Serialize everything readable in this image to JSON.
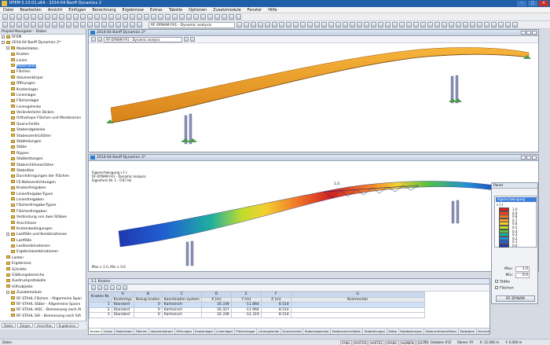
{
  "app": {
    "title": "RFEM 5.10.01.x64 - 2014-04 Banff Dynamics 2",
    "menus": [
      "Datei",
      "Bearbeiten",
      "Ansicht",
      "Einfügen",
      "Berechnung",
      "Ergebnisse",
      "Extras",
      "Tabelle",
      "Optionen",
      "Zusatzmodule",
      "Fenster",
      "Hilfe"
    ],
    "toolbar_select": "RF-DYNAM FA1 - Dynamic analysis"
  },
  "navigator": {
    "title": "Projekt-Navigator - Daten",
    "items": [
      {
        "label": "RFEM",
        "level": 0,
        "exp": true
      },
      {
        "label": "2014-04 Banff Dynamics 2*",
        "level": 0,
        "exp": true
      },
      {
        "label": "Modelldaten",
        "level": 1,
        "exp": true
      },
      {
        "label": "Knoten",
        "level": 2
      },
      {
        "label": "Linien",
        "level": 2
      },
      {
        "label": "Materialien",
        "level": 2,
        "sel": true
      },
      {
        "label": "Flächen",
        "level": 2
      },
      {
        "label": "Volumenkörper",
        "level": 2
      },
      {
        "label": "Öffnungen",
        "level": 2
      },
      {
        "label": "Knotenlager",
        "level": 2
      },
      {
        "label": "Linienlager",
        "level": 2
      },
      {
        "label": "Flächenlager",
        "level": 2
      },
      {
        "label": "Liniengelenke",
        "level": 2
      },
      {
        "label": "Veränderliche Dicken",
        "level": 2
      },
      {
        "label": "Orthotrope Flächen und Membranen",
        "level": 2
      },
      {
        "label": "Querschnitte",
        "level": 2
      },
      {
        "label": "Stabendgelenke",
        "level": 2
      },
      {
        "label": "Stabexzentrizitäten",
        "level": 2
      },
      {
        "label": "Stabteilungen",
        "level": 2
      },
      {
        "label": "Stäbe",
        "level": 2
      },
      {
        "label": "Rippen",
        "level": 2
      },
      {
        "label": "Stabbettungen",
        "level": 2
      },
      {
        "label": "Stabnichtlinearitäten",
        "level": 2
      },
      {
        "label": "Stabsätze",
        "level": 2
      },
      {
        "label": "Durchdringungen der Flächen",
        "level": 2
      },
      {
        "label": "FE-Netzverdichtungen",
        "level": 2
      },
      {
        "label": "Knotenfreigaben",
        "level": 2
      },
      {
        "label": "Linienfreigabe-Typen",
        "level": 2
      },
      {
        "label": "Linienfreigaben",
        "level": 2
      },
      {
        "label": "Flächenfreigabe-Typen",
        "level": 2
      },
      {
        "label": "Flächenfreigaben",
        "level": 2
      },
      {
        "label": "Verbindung von zwei Stäben",
        "level": 2
      },
      {
        "label": "Anschlüsse",
        "level": 2
      },
      {
        "label": "Knotenbedingungen",
        "level": 2
      },
      {
        "label": "Lastfälle und Kombinationen",
        "level": 1,
        "exp": true
      },
      {
        "label": "Lastfälle",
        "level": 2
      },
      {
        "label": "Lastkombinationen",
        "level": 2
      },
      {
        "label": "Ergebniskombinationen",
        "level": 2
      },
      {
        "label": "Lasten",
        "level": 1
      },
      {
        "label": "Ergebnisse",
        "level": 1
      },
      {
        "label": "Schnitte",
        "level": 1
      },
      {
        "label": "Glättungsbereiche",
        "level": 1
      },
      {
        "label": "Ausdruckprotokolle",
        "level": 1
      },
      {
        "label": "Hilfsobjekte",
        "level": 1
      },
      {
        "label": "Zusatzmodule",
        "level": 1,
        "exp": true
      },
      {
        "label": "RF-STAHL Flächen - Allgemeine Span",
        "level": 2
      },
      {
        "label": "RF-STAHL Stäbe - Allgemeine Spann",
        "level": 2
      },
      {
        "label": "RF-STAHL AISC - Bemessung nach AI",
        "level": 2
      },
      {
        "label": "RF-STAHL SIA - Bemessung nach SIA",
        "level": 2
      },
      {
        "label": "RF-STAHL BS - Bemessung nach BS",
        "level": 2
      },
      {
        "label": "RF-STAHL GB - Bemessung nach GB",
        "level": 2
      },
      {
        "label": "RF-STAHL CS - Bemessung nach CS",
        "level": 2
      },
      {
        "label": "RF-STAHL AS - Bemessung nach AS",
        "level": 2
      },
      {
        "label": "RF-STAHL NTC-DF - Bemessung nach",
        "level": 2
      }
    ],
    "tabs": [
      "Daten",
      "Zeigen",
      "Ansichten",
      "Ergebnisse"
    ]
  },
  "view1": {
    "title": "2014-04 Banff Dynamics 2*",
    "select": "RF-DYNAM FA1 - Dynamic analysis"
  },
  "view2": {
    "title": "2014-04 Banff Dynamics 2*",
    "info": [
      "Eigenschwingung v [-]",
      "RF-DYNAM FA1 - Dynamic analysis",
      "Eigenform Nr. 1 - 0.87 Hz"
    ],
    "maxmin": "Max v: 1.0, Min v: 0.0",
    "label": "1.0"
  },
  "panel": {
    "title": "Panel",
    "header": "Eigenschwingung",
    "unit": "v [-]",
    "legend": [
      {
        "v": "1.0",
        "c": "#d02020"
      },
      {
        "v": "0.9",
        "c": "#ee4420"
      },
      {
        "v": "0.8",
        "c": "#f07828"
      },
      {
        "v": "0.7",
        "c": "#f5a030"
      },
      {
        "v": "0.6",
        "c": "#f3d030"
      },
      {
        "v": "0.5",
        "c": "#c2dc2c"
      },
      {
        "v": "0.4",
        "c": "#56c040"
      },
      {
        "v": "0.3",
        "c": "#20b0a0"
      },
      {
        "v": "0.2",
        "c": "#2090d8"
      },
      {
        "v": "0.1",
        "c": "#2060d0"
      },
      {
        "v": "0.0",
        "c": "#2038b0"
      }
    ],
    "max_label": "Max:",
    "max": "1.0",
    "min_label": "Min:",
    "min": "0.0",
    "cb1": "Stäbe",
    "cb2": "Flächen",
    "button": "RF-DYNAM"
  },
  "table": {
    "title": "1.1 Knoten",
    "col_letters": [
      "A",
      "B",
      "C",
      "D",
      "E",
      "F",
      "G"
    ],
    "headers": [
      "Knoten Nr.",
      "Knotentyp",
      "Bezug knoten",
      "Koordinaten-system",
      "X [m]",
      "Y [m]",
      "Z [m]",
      "Kommentar"
    ],
    "group_header": "Knotenkoordinaten",
    "rows": [
      [
        "1",
        "Standard",
        "0",
        "Kartesisch",
        "16.336",
        "-11.864",
        "8.514",
        ""
      ],
      [
        "2",
        "Standard",
        "0",
        "Kartesisch",
        "16.327",
        "-11.964",
        "8.514",
        ""
      ],
      [
        "3",
        "Standard",
        "0",
        "Kartesisch",
        "16.336",
        "-12.319",
        "8.514",
        ""
      ]
    ],
    "tabs": [
      "Knoten",
      "Linien",
      "Materialien",
      "Flächen",
      "Volumenkörper",
      "Öffnungen",
      "Knotenlager",
      "Linienlager",
      "Flächenlager",
      "Liniengelenke",
      "Querschnitte",
      "Stabendgelenke",
      "Stabexzentrizitäten",
      "Stabteilungen",
      "Stäbe",
      "Stabbettungen",
      "Stabnichtlinearitäten",
      "Stabsätze",
      "Durchdringungen",
      "FE-Netzverdichtungen",
      "Knote"
    ]
  },
  "status": {
    "left": "Daten",
    "buttons": [
      "FANG",
      "RASTER",
      "KARTES",
      "OFANG",
      "HLINIEN",
      "DXF"
    ],
    "cs": "KS: Globales XYZ",
    "plane": "Ebene: XY",
    "x": "X: 12.000 m",
    "y": "Y: 0.000 m"
  },
  "colors": {
    "orange": "#f0a020",
    "accent": "#1f5fa8"
  }
}
